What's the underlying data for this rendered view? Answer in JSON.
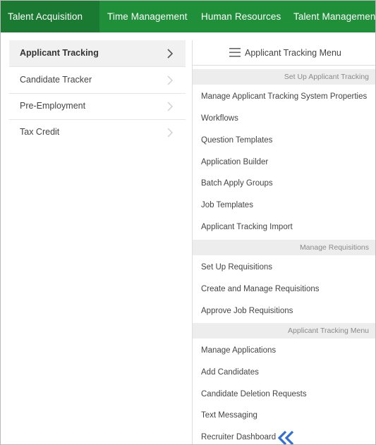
{
  "topnav": {
    "tabs": [
      {
        "label": "Talent Acquisition",
        "active": true
      },
      {
        "label": "Time Management"
      },
      {
        "label": "Human Resources"
      },
      {
        "label": "Talent Management"
      }
    ],
    "background": "#1f8f3a"
  },
  "left_panel": {
    "items": [
      {
        "label": "Applicant Tracking",
        "active": true
      },
      {
        "label": "Candidate Tracker"
      },
      {
        "label": "Pre-Employment"
      },
      {
        "label": "Tax Credit"
      }
    ]
  },
  "right_panel": {
    "title": "Applicant Tracking Menu",
    "sections": [
      {
        "header": "Set Up Applicant Tracking",
        "items": [
          "Manage Applicant Tracking System Properties",
          "Workflows",
          "Question Templates",
          "Application Builder",
          "Batch Apply Groups",
          "Job Templates",
          "Applicant Tracking Import"
        ]
      },
      {
        "header": "Manage Requisitions",
        "items": [
          "Set Up Requisitions",
          "Create and Manage Requisitions",
          "Approve Job Requisitions"
        ]
      },
      {
        "header": "Applicant Tracking Menu",
        "items": [
          "Manage Applications",
          "Add Candidates",
          "Candidate Deletion Requests",
          "Text Messaging",
          "Recruiter Dashboard"
        ]
      }
    ]
  },
  "icons": {
    "menu": "hamburger-menu-icon",
    "chevron": "chevron-right-icon",
    "indicator": "double-chevron-left-icon",
    "indicator_color": "#2f6fd6"
  }
}
